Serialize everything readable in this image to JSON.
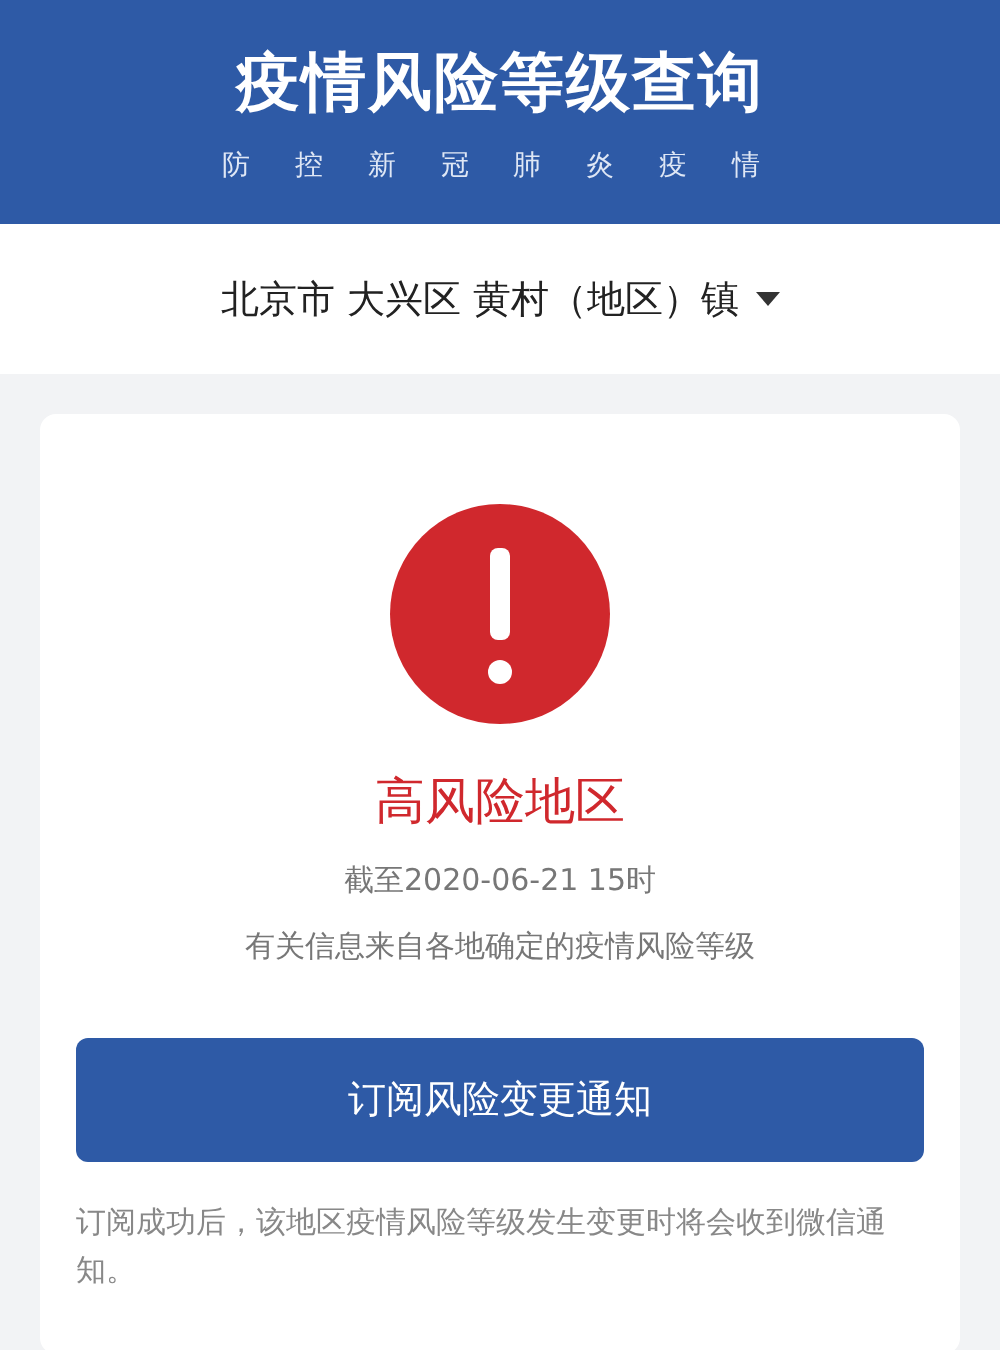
{
  "header": {
    "title": "疫情风险等级查询",
    "subtitle": "防控新冠肺炎疫情"
  },
  "location": {
    "text": "北京市 大兴区 黄村（地区）镇"
  },
  "result": {
    "kind": "high",
    "title": "高风险地区",
    "time": "截至2020-06-21 15时",
    "source": "有关信息来自各地确定的疫情风险等级"
  },
  "subscribe_button": "订阅风险变更通知",
  "note": "订阅成功后，该地区疫情风险等级发生变更时将会收到微信通知。"
}
